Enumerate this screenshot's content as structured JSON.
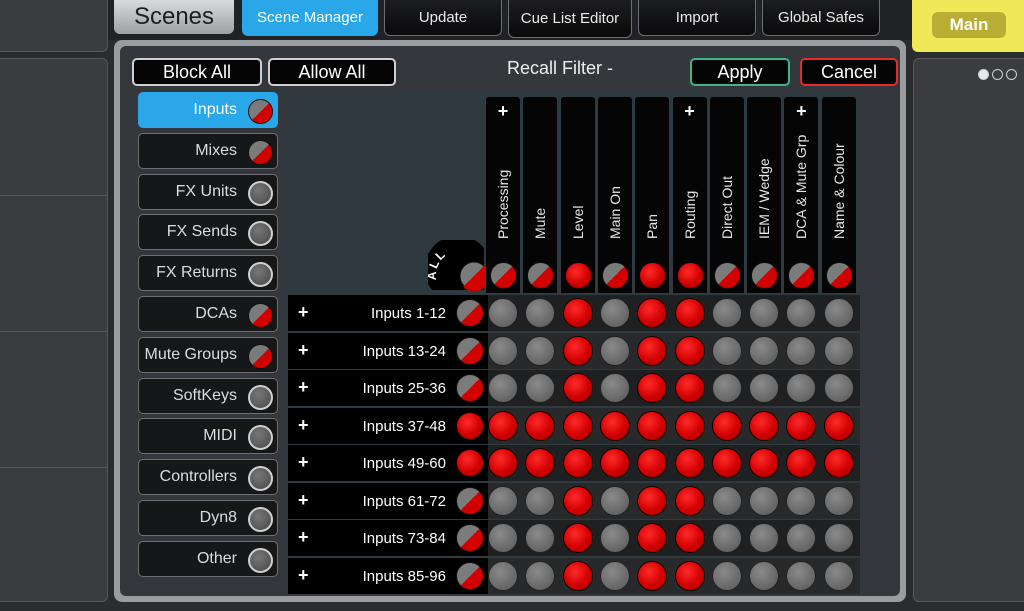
{
  "header": {
    "title": "Scenes",
    "tabs": [
      {
        "label": "Scene Manager",
        "active": true
      },
      {
        "label": "Update",
        "active": false
      },
      {
        "label": "Cue List Editor",
        "active": false
      },
      {
        "label": "Import",
        "active": false
      },
      {
        "label": "Global Safes",
        "active": false
      }
    ],
    "main_label": "Main"
  },
  "page_dots": {
    "count": 3,
    "active_index": 0
  },
  "dialog": {
    "title": "Recall Filter -",
    "block_all": "Block All",
    "allow_all": "Allow All",
    "apply": "Apply",
    "cancel": "Cancel",
    "all_label": "ALL",
    "all_state": "mixed"
  },
  "categories": [
    {
      "label": "Inputs",
      "state": "mixed",
      "active": true
    },
    {
      "label": "Mixes",
      "state": "mixed",
      "active": false
    },
    {
      "label": "FX Units",
      "state": "off",
      "active": false
    },
    {
      "label": "FX Sends",
      "state": "off",
      "active": false
    },
    {
      "label": "FX Returns",
      "state": "off",
      "active": false
    },
    {
      "label": "DCAs",
      "state": "mixed",
      "active": false
    },
    {
      "label": "Mute Groups",
      "state": "mixed",
      "active": false
    },
    {
      "label": "SoftKeys",
      "state": "off",
      "active": false
    },
    {
      "label": "MIDI",
      "state": "off",
      "active": false
    },
    {
      "label": "Controllers",
      "state": "off",
      "active": false
    },
    {
      "label": "Dyn8",
      "state": "off",
      "active": false
    },
    {
      "label": "Other",
      "state": "off",
      "active": false
    }
  ],
  "columns": [
    {
      "label": "Processing",
      "expandable": true,
      "state": "mixed"
    },
    {
      "label": "Mute",
      "expandable": false,
      "state": "mixed"
    },
    {
      "label": "Level",
      "expandable": false,
      "state": "on"
    },
    {
      "label": "Main On",
      "expandable": false,
      "state": "mixed"
    },
    {
      "label": "Pan",
      "expandable": false,
      "state": "on"
    },
    {
      "label": "Routing",
      "expandable": true,
      "state": "on"
    },
    {
      "label": "Direct Out",
      "expandable": false,
      "state": "mixed"
    },
    {
      "label": "IEM / Wedge",
      "expandable": false,
      "state": "mixed"
    },
    {
      "label": "DCA & Mute Grp",
      "expandable": true,
      "state": "mixed"
    },
    {
      "label": "Name & Colour",
      "expandable": false,
      "state": "mixed"
    }
  ],
  "rows": [
    {
      "label": "Inputs 1-12",
      "state": "mixed",
      "cells": [
        "off",
        "off",
        "on",
        "off",
        "on",
        "on",
        "off",
        "off",
        "off",
        "off"
      ]
    },
    {
      "label": "Inputs 13-24",
      "state": "mixed",
      "cells": [
        "off",
        "off",
        "on",
        "off",
        "on",
        "on",
        "off",
        "off",
        "off",
        "off"
      ]
    },
    {
      "label": "Inputs 25-36",
      "state": "mixed",
      "cells": [
        "off",
        "off",
        "on",
        "off",
        "on",
        "on",
        "off",
        "off",
        "off",
        "off"
      ]
    },
    {
      "label": "Inputs 37-48",
      "state": "on",
      "cells": [
        "on",
        "on",
        "on",
        "on",
        "on",
        "on",
        "on",
        "on",
        "on",
        "on"
      ]
    },
    {
      "label": "Inputs 49-60",
      "state": "on",
      "cells": [
        "on",
        "on",
        "on",
        "on",
        "on",
        "on",
        "on",
        "on",
        "on",
        "on"
      ]
    },
    {
      "label": "Inputs 61-72",
      "state": "mixed",
      "cells": [
        "off",
        "off",
        "on",
        "off",
        "on",
        "on",
        "off",
        "off",
        "off",
        "off"
      ]
    },
    {
      "label": "Inputs 73-84",
      "state": "mixed",
      "cells": [
        "off",
        "off",
        "on",
        "off",
        "on",
        "on",
        "off",
        "off",
        "off",
        "off"
      ]
    },
    {
      "label": "Inputs 85-96",
      "state": "mixed",
      "cells": [
        "off",
        "off",
        "on",
        "off",
        "on",
        "on",
        "off",
        "off",
        "off",
        "off"
      ]
    }
  ],
  "colors": {
    "accent": "#29a7e8",
    "on": "#d10000",
    "main": "#f1e858",
    "apply_border": "#3bb58a",
    "cancel_border": "#e52a2a"
  }
}
